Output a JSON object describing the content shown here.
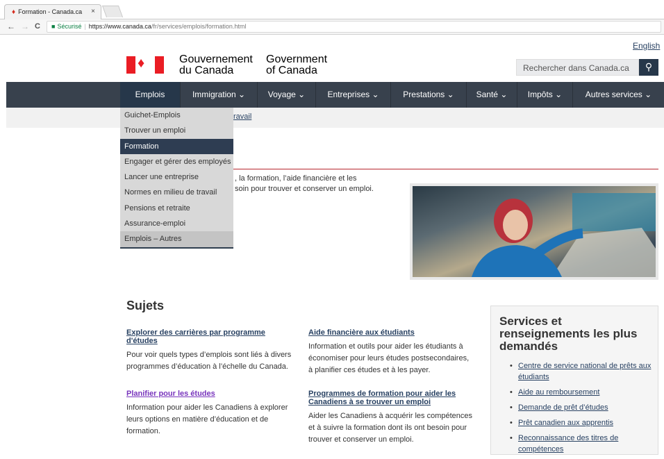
{
  "browser": {
    "tab_title": "Formation - Canada.ca",
    "tab_close": "×",
    "back": "←",
    "forward": "→",
    "reload": "C",
    "secure_label": "Sécurisé",
    "url_host": "https://www.canada.ca",
    "url_path": "/fr/services/emplois/formation.html"
  },
  "header": {
    "lang_link": "English",
    "sig_fr_1": "Gouvernement",
    "sig_fr_2": "du Canada",
    "sig_en_1": "Government",
    "sig_en_2": "of Canada",
    "search_placeholder": "Rechercher dans Canada.ca"
  },
  "menu": [
    "Emplois",
    "Immigration ⌄",
    "Voyage ⌄",
    "Entreprises ⌄",
    "Prestations ⌄",
    "Santé ⌄",
    "Impôts ⌄",
    "Autres services ⌄"
  ],
  "breadcrumb_partial": "ravail",
  "dropdown": [
    "Guichet-Emplois",
    "Trouver un emploi",
    "Formation",
    "Engager et gérer des employés",
    "Lancer une entreprise",
    "Normes en milieu de travail",
    "Pensions et retraite",
    "Assurance-emploi",
    "Emplois – Autres"
  ],
  "intro": {
    "line1": ", la formation, l’aide financière et les",
    "line2": "soin pour trouver et conserver un emploi."
  },
  "topics": {
    "heading": "Sujets",
    "items": [
      {
        "title": "Explorer des carrières par programme d'études",
        "desc": "Pour voir quels types d’emplois sont liés à divers programmes d’éducation à l’échelle du Canada."
      },
      {
        "title": "Aide financière aux étudiants",
        "desc": "Information et outils pour aider les étudiants à économiser pour leurs études postsecondaires, à planifier ces études et à les payer."
      },
      {
        "title": "Planifier pour les études",
        "desc": "Information pour aider les Canadiens à explorer leurs options en matière d’éducation et de formation."
      },
      {
        "title": "Programmes de formation pour aider les Canadiens à se trouver un emploi",
        "desc": "Aider les Canadiens à acquérir les compétences et à suivre la formation dont ils ont besoin pour trouver et conserver un emploi."
      }
    ]
  },
  "services": {
    "title": "Services et renseignements les plus demandés",
    "links": [
      "Centre de service national de prêts aux étudiants",
      "Aide au remboursement",
      "Demande de prêt d’études",
      "Prêt canadien aux apprentis",
      "Reconnaissance des titres de compétences"
    ]
  },
  "colors": {
    "menu_bg": "#38414d",
    "active_menu": "#26374a",
    "link": "#284162",
    "visited_link": "#7834bc",
    "flag_red": "#ea1d24",
    "rule_red": "#b8262e"
  }
}
